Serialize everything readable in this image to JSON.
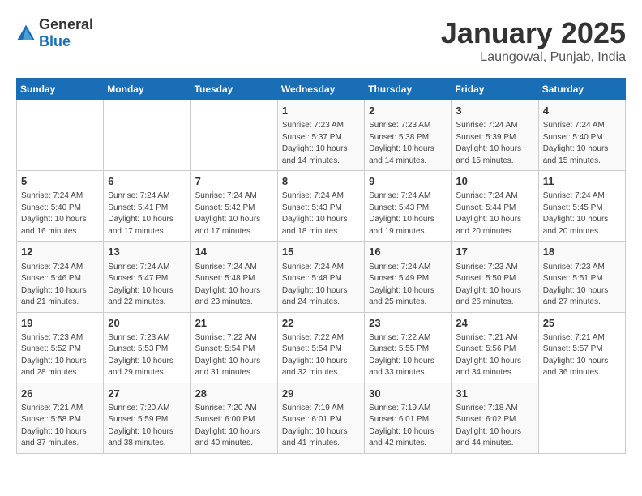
{
  "logo": {
    "text_general": "General",
    "text_blue": "Blue"
  },
  "header": {
    "title": "January 2025",
    "subtitle": "Laungowal, Punjab, India"
  },
  "days_of_week": [
    "Sunday",
    "Monday",
    "Tuesday",
    "Wednesday",
    "Thursday",
    "Friday",
    "Saturday"
  ],
  "weeks": [
    [
      {
        "day": "",
        "info": ""
      },
      {
        "day": "",
        "info": ""
      },
      {
        "day": "",
        "info": ""
      },
      {
        "day": "1",
        "info": "Sunrise: 7:23 AM\nSunset: 5:37 PM\nDaylight: 10 hours\nand 14 minutes."
      },
      {
        "day": "2",
        "info": "Sunrise: 7:23 AM\nSunset: 5:38 PM\nDaylight: 10 hours\nand 14 minutes."
      },
      {
        "day": "3",
        "info": "Sunrise: 7:24 AM\nSunset: 5:39 PM\nDaylight: 10 hours\nand 15 minutes."
      },
      {
        "day": "4",
        "info": "Sunrise: 7:24 AM\nSunset: 5:40 PM\nDaylight: 10 hours\nand 15 minutes."
      }
    ],
    [
      {
        "day": "5",
        "info": "Sunrise: 7:24 AM\nSunset: 5:40 PM\nDaylight: 10 hours\nand 16 minutes."
      },
      {
        "day": "6",
        "info": "Sunrise: 7:24 AM\nSunset: 5:41 PM\nDaylight: 10 hours\nand 17 minutes."
      },
      {
        "day": "7",
        "info": "Sunrise: 7:24 AM\nSunset: 5:42 PM\nDaylight: 10 hours\nand 17 minutes."
      },
      {
        "day": "8",
        "info": "Sunrise: 7:24 AM\nSunset: 5:43 PM\nDaylight: 10 hours\nand 18 minutes."
      },
      {
        "day": "9",
        "info": "Sunrise: 7:24 AM\nSunset: 5:43 PM\nDaylight: 10 hours\nand 19 minutes."
      },
      {
        "day": "10",
        "info": "Sunrise: 7:24 AM\nSunset: 5:44 PM\nDaylight: 10 hours\nand 20 minutes."
      },
      {
        "day": "11",
        "info": "Sunrise: 7:24 AM\nSunset: 5:45 PM\nDaylight: 10 hours\nand 20 minutes."
      }
    ],
    [
      {
        "day": "12",
        "info": "Sunrise: 7:24 AM\nSunset: 5:46 PM\nDaylight: 10 hours\nand 21 minutes."
      },
      {
        "day": "13",
        "info": "Sunrise: 7:24 AM\nSunset: 5:47 PM\nDaylight: 10 hours\nand 22 minutes."
      },
      {
        "day": "14",
        "info": "Sunrise: 7:24 AM\nSunset: 5:48 PM\nDaylight: 10 hours\nand 23 minutes."
      },
      {
        "day": "15",
        "info": "Sunrise: 7:24 AM\nSunset: 5:48 PM\nDaylight: 10 hours\nand 24 minutes."
      },
      {
        "day": "16",
        "info": "Sunrise: 7:24 AM\nSunset: 5:49 PM\nDaylight: 10 hours\nand 25 minutes."
      },
      {
        "day": "17",
        "info": "Sunrise: 7:23 AM\nSunset: 5:50 PM\nDaylight: 10 hours\nand 26 minutes."
      },
      {
        "day": "18",
        "info": "Sunrise: 7:23 AM\nSunset: 5:51 PM\nDaylight: 10 hours\nand 27 minutes."
      }
    ],
    [
      {
        "day": "19",
        "info": "Sunrise: 7:23 AM\nSunset: 5:52 PM\nDaylight: 10 hours\nand 28 minutes."
      },
      {
        "day": "20",
        "info": "Sunrise: 7:23 AM\nSunset: 5:53 PM\nDaylight: 10 hours\nand 29 minutes."
      },
      {
        "day": "21",
        "info": "Sunrise: 7:22 AM\nSunset: 5:54 PM\nDaylight: 10 hours\nand 31 minutes."
      },
      {
        "day": "22",
        "info": "Sunrise: 7:22 AM\nSunset: 5:54 PM\nDaylight: 10 hours\nand 32 minutes."
      },
      {
        "day": "23",
        "info": "Sunrise: 7:22 AM\nSunset: 5:55 PM\nDaylight: 10 hours\nand 33 minutes."
      },
      {
        "day": "24",
        "info": "Sunrise: 7:21 AM\nSunset: 5:56 PM\nDaylight: 10 hours\nand 34 minutes."
      },
      {
        "day": "25",
        "info": "Sunrise: 7:21 AM\nSunset: 5:57 PM\nDaylight: 10 hours\nand 36 minutes."
      }
    ],
    [
      {
        "day": "26",
        "info": "Sunrise: 7:21 AM\nSunset: 5:58 PM\nDaylight: 10 hours\nand 37 minutes."
      },
      {
        "day": "27",
        "info": "Sunrise: 7:20 AM\nSunset: 5:59 PM\nDaylight: 10 hours\nand 38 minutes."
      },
      {
        "day": "28",
        "info": "Sunrise: 7:20 AM\nSunset: 6:00 PM\nDaylight: 10 hours\nand 40 minutes."
      },
      {
        "day": "29",
        "info": "Sunrise: 7:19 AM\nSunset: 6:01 PM\nDaylight: 10 hours\nand 41 minutes."
      },
      {
        "day": "30",
        "info": "Sunrise: 7:19 AM\nSunset: 6:01 PM\nDaylight: 10 hours\nand 42 minutes."
      },
      {
        "day": "31",
        "info": "Sunrise: 7:18 AM\nSunset: 6:02 PM\nDaylight: 10 hours\nand 44 minutes."
      },
      {
        "day": "",
        "info": ""
      }
    ]
  ]
}
